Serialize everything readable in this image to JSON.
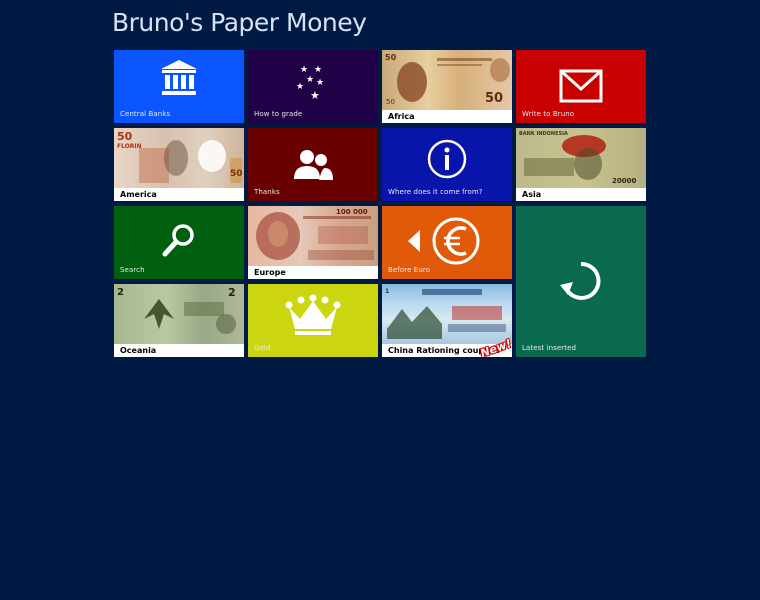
{
  "site": {
    "title": "Bruno's Paper Money"
  },
  "tiles": {
    "central_banks": {
      "label": "Central Banks",
      "color": "#0a55ff"
    },
    "how_to_grade": {
      "label": "How to grade",
      "color": "#200046"
    },
    "africa": {
      "label": "Africa"
    },
    "write": {
      "label": "Write to Bruno",
      "color": "#c80000"
    },
    "america": {
      "label": "America"
    },
    "thanks": {
      "label": "Thanks",
      "color": "#680000"
    },
    "where": {
      "label": "Where does it come from?",
      "color": "#0814aa"
    },
    "asia": {
      "label": "Asia"
    },
    "search": {
      "label": "Search",
      "color": "#006010"
    },
    "europe": {
      "label": "Europe"
    },
    "before_euro": {
      "label": "Before Euro",
      "color": "#e05a0a"
    },
    "latest": {
      "label": "Latest inserted",
      "color": "#0a6a50"
    },
    "oceania": {
      "label": "Oceania"
    },
    "gold": {
      "label": "Gold",
      "color": "#cbd610"
    },
    "china": {
      "label": "China Rationing coupons",
      "badge": "New!"
    }
  },
  "icons": {
    "central_banks": "bank-icon",
    "how_to_grade": "stars-icon",
    "write": "envelope-icon",
    "thanks": "people-icon",
    "where": "info-icon",
    "search": "search-icon",
    "before_euro": "euro-icon",
    "latest": "refresh-icon",
    "gold": "crown-icon"
  }
}
